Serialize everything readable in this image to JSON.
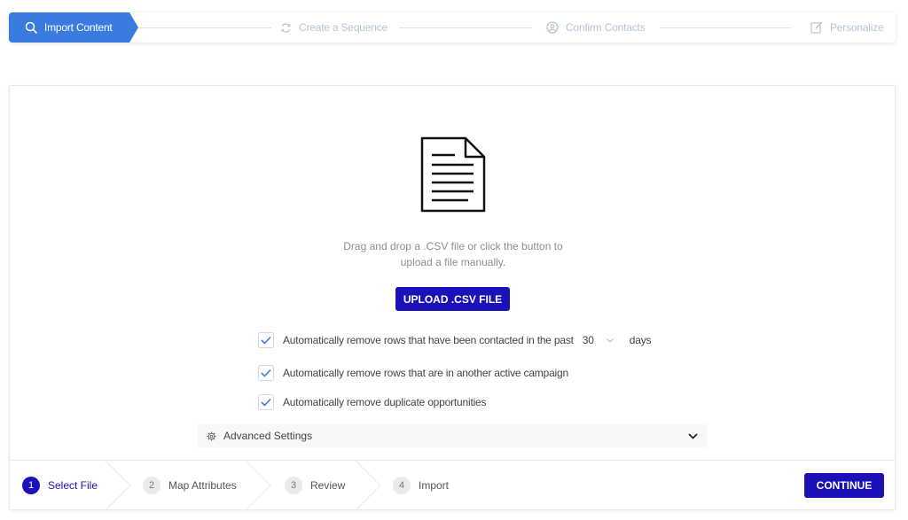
{
  "top_steps": [
    {
      "label": "Import Content",
      "icon": "search-icon",
      "active": true
    },
    {
      "label": "Create a Sequence",
      "icon": "refresh-icon",
      "active": false
    },
    {
      "label": "Confirm Contacts",
      "icon": "user-circle-icon",
      "active": false
    },
    {
      "label": "Personalize",
      "icon": "edit-icon",
      "active": false
    }
  ],
  "upload": {
    "icon": "document-icon",
    "instruction_line1": "Drag and drop a .CSV file or click the button to",
    "instruction_line2": "upload a file manually.",
    "button_label": "UPLOAD .CSV FILE"
  },
  "options": {
    "contacted_prefix": "Automatically remove rows that have been contacted in the past",
    "days_value": "30",
    "days_suffix": "days",
    "active_campaign": "Automatically remove rows that are in another active campaign",
    "duplicates": "Automatically remove duplicate opportunities"
  },
  "advanced": {
    "label": "Advanced Settings"
  },
  "wizard": {
    "steps": [
      {
        "num": "1",
        "label": "Select File"
      },
      {
        "num": "2",
        "label": "Map Attributes"
      },
      {
        "num": "3",
        "label": "Review"
      },
      {
        "num": "4",
        "label": "Import"
      }
    ],
    "continue_label": "CONTINUE"
  },
  "colors": {
    "primary": "#1a11b8",
    "active_step": "#3a7be0",
    "inactive_text": "#b9c4d4"
  }
}
